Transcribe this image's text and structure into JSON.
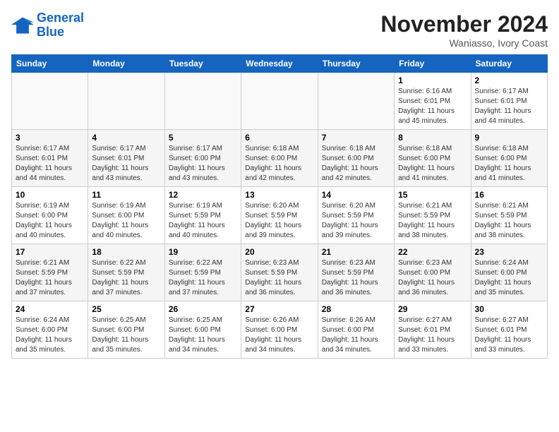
{
  "header": {
    "logo_line1": "General",
    "logo_line2": "Blue",
    "month": "November 2024",
    "location": "Waniasso, Ivory Coast"
  },
  "weekdays": [
    "Sunday",
    "Monday",
    "Tuesday",
    "Wednesday",
    "Thursday",
    "Friday",
    "Saturday"
  ],
  "weeks": [
    [
      {
        "day": "",
        "info": ""
      },
      {
        "day": "",
        "info": ""
      },
      {
        "day": "",
        "info": ""
      },
      {
        "day": "",
        "info": ""
      },
      {
        "day": "",
        "info": ""
      },
      {
        "day": "1",
        "info": "Sunrise: 6:16 AM\nSunset: 6:01 PM\nDaylight: 11 hours\nand 45 minutes."
      },
      {
        "day": "2",
        "info": "Sunrise: 6:17 AM\nSunset: 6:01 PM\nDaylight: 11 hours\nand 44 minutes."
      }
    ],
    [
      {
        "day": "3",
        "info": "Sunrise: 6:17 AM\nSunset: 6:01 PM\nDaylight: 11 hours\nand 44 minutes."
      },
      {
        "day": "4",
        "info": "Sunrise: 6:17 AM\nSunset: 6:01 PM\nDaylight: 11 hours\nand 43 minutes."
      },
      {
        "day": "5",
        "info": "Sunrise: 6:17 AM\nSunset: 6:00 PM\nDaylight: 11 hours\nand 43 minutes."
      },
      {
        "day": "6",
        "info": "Sunrise: 6:18 AM\nSunset: 6:00 PM\nDaylight: 11 hours\nand 42 minutes."
      },
      {
        "day": "7",
        "info": "Sunrise: 6:18 AM\nSunset: 6:00 PM\nDaylight: 11 hours\nand 42 minutes."
      },
      {
        "day": "8",
        "info": "Sunrise: 6:18 AM\nSunset: 6:00 PM\nDaylight: 11 hours\nand 41 minutes."
      },
      {
        "day": "9",
        "info": "Sunrise: 6:18 AM\nSunset: 6:00 PM\nDaylight: 11 hours\nand 41 minutes."
      }
    ],
    [
      {
        "day": "10",
        "info": "Sunrise: 6:19 AM\nSunset: 6:00 PM\nDaylight: 11 hours\nand 40 minutes."
      },
      {
        "day": "11",
        "info": "Sunrise: 6:19 AM\nSunset: 6:00 PM\nDaylight: 11 hours\nand 40 minutes."
      },
      {
        "day": "12",
        "info": "Sunrise: 6:19 AM\nSunset: 5:59 PM\nDaylight: 11 hours\nand 40 minutes."
      },
      {
        "day": "13",
        "info": "Sunrise: 6:20 AM\nSunset: 5:59 PM\nDaylight: 11 hours\nand 39 minutes."
      },
      {
        "day": "14",
        "info": "Sunrise: 6:20 AM\nSunset: 5:59 PM\nDaylight: 11 hours\nand 39 minutes."
      },
      {
        "day": "15",
        "info": "Sunrise: 6:21 AM\nSunset: 5:59 PM\nDaylight: 11 hours\nand 38 minutes."
      },
      {
        "day": "16",
        "info": "Sunrise: 6:21 AM\nSunset: 5:59 PM\nDaylight: 11 hours\nand 38 minutes."
      }
    ],
    [
      {
        "day": "17",
        "info": "Sunrise: 6:21 AM\nSunset: 5:59 PM\nDaylight: 11 hours\nand 37 minutes."
      },
      {
        "day": "18",
        "info": "Sunrise: 6:22 AM\nSunset: 5:59 PM\nDaylight: 11 hours\nand 37 minutes."
      },
      {
        "day": "19",
        "info": "Sunrise: 6:22 AM\nSunset: 5:59 PM\nDaylight: 11 hours\nand 37 minutes."
      },
      {
        "day": "20",
        "info": "Sunrise: 6:23 AM\nSunset: 5:59 PM\nDaylight: 11 hours\nand 36 minutes."
      },
      {
        "day": "21",
        "info": "Sunrise: 6:23 AM\nSunset: 5:59 PM\nDaylight: 11 hours\nand 36 minutes."
      },
      {
        "day": "22",
        "info": "Sunrise: 6:23 AM\nSunset: 6:00 PM\nDaylight: 11 hours\nand 36 minutes."
      },
      {
        "day": "23",
        "info": "Sunrise: 6:24 AM\nSunset: 6:00 PM\nDaylight: 11 hours\nand 35 minutes."
      }
    ],
    [
      {
        "day": "24",
        "info": "Sunrise: 6:24 AM\nSunset: 6:00 PM\nDaylight: 11 hours\nand 35 minutes."
      },
      {
        "day": "25",
        "info": "Sunrise: 6:25 AM\nSunset: 6:00 PM\nDaylight: 11 hours\nand 35 minutes."
      },
      {
        "day": "26",
        "info": "Sunrise: 6:25 AM\nSunset: 6:00 PM\nDaylight: 11 hours\nand 34 minutes."
      },
      {
        "day": "27",
        "info": "Sunrise: 6:26 AM\nSunset: 6:00 PM\nDaylight: 11 hours\nand 34 minutes."
      },
      {
        "day": "28",
        "info": "Sunrise: 6:26 AM\nSunset: 6:00 PM\nDaylight: 11 hours\nand 34 minutes."
      },
      {
        "day": "29",
        "info": "Sunrise: 6:27 AM\nSunset: 6:01 PM\nDaylight: 11 hours\nand 33 minutes."
      },
      {
        "day": "30",
        "info": "Sunrise: 6:27 AM\nSunset: 6:01 PM\nDaylight: 11 hours\nand 33 minutes."
      }
    ]
  ]
}
